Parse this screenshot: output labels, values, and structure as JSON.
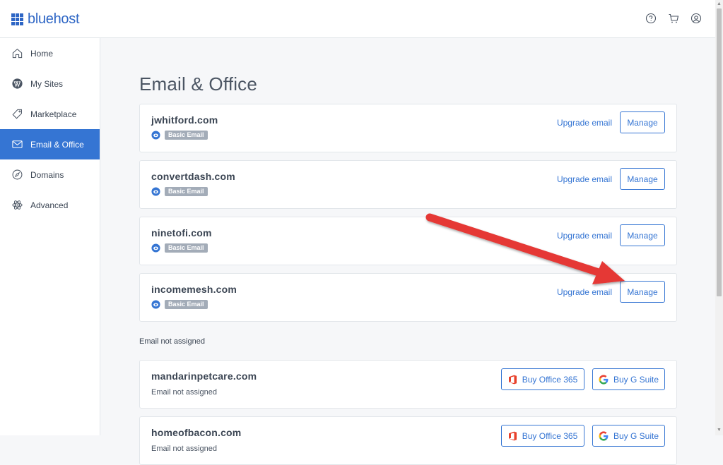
{
  "app": {
    "logo_text": "bluehost"
  },
  "topbar": {
    "icons": [
      "help-icon",
      "cart-icon",
      "account-icon"
    ]
  },
  "sidebar": {
    "items": [
      {
        "label": "Home",
        "icon": "home-icon",
        "active": false
      },
      {
        "label": "My Sites",
        "icon": "wordpress-icon",
        "active": false
      },
      {
        "label": "Marketplace",
        "icon": "tag-icon",
        "active": false
      },
      {
        "label": "Email & Office",
        "icon": "mail-icon",
        "active": true
      },
      {
        "label": "Domains",
        "icon": "compass-icon",
        "active": false
      },
      {
        "label": "Advanced",
        "icon": "atom-icon",
        "active": false
      }
    ]
  },
  "main": {
    "title": "Email & Office",
    "assigned": [
      {
        "domain": "jwhitford.com",
        "badge": "Basic Email",
        "upgrade_label": "Upgrade email",
        "manage_label": "Manage"
      },
      {
        "domain": "convertdash.com",
        "badge": "Basic Email",
        "upgrade_label": "Upgrade email",
        "manage_label": "Manage"
      },
      {
        "domain": "ninetofi.com",
        "badge": "Basic Email",
        "upgrade_label": "Upgrade email",
        "manage_label": "Manage"
      },
      {
        "domain": "incomemesh.com",
        "badge": "Basic Email",
        "upgrade_label": "Upgrade email",
        "manage_label": "Manage"
      }
    ],
    "unassigned_heading": "Email not assigned",
    "unassigned": [
      {
        "domain": "mandarinpetcare.com",
        "status": "Email not assigned",
        "office_label": "Buy Office 365",
        "gsuite_label": "Buy G Suite"
      },
      {
        "domain": "homeofbacon.com",
        "status": "Email not assigned",
        "office_label": "Buy Office 365",
        "gsuite_label": "Buy G Suite"
      }
    ]
  },
  "colors": {
    "accent": "#3575d3",
    "annotation_arrow": "#e53935",
    "badge": "#a3acb8"
  }
}
